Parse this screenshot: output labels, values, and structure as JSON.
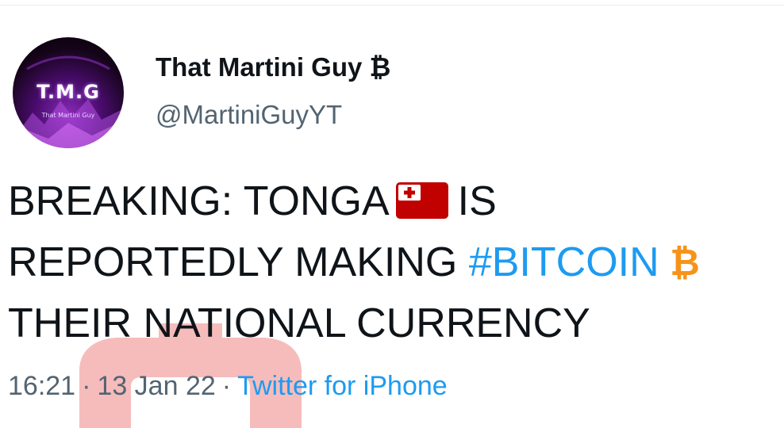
{
  "account": {
    "display_name": "That Martini Guy ₿",
    "handle": "@MartiniGuyYT",
    "avatar_logo_text": "T.M.G",
    "avatar_tagline": "That Martini Guy"
  },
  "tweet": {
    "text_line1": "BREAKING: TONGA",
    "text_line1_after_flag": "IS",
    "text_line2": "REPORTEDLY MAKING",
    "hashtag": "#BITCOIN",
    "text_line3": "THEIR NATIONAL CURRENCY",
    "flag_icon": "tonga-flag-emoji",
    "btc_icon": "bitcoin-emoji"
  },
  "meta": {
    "time": "16:21",
    "separator": "·",
    "date": "13 Jan 22",
    "source": "Twitter for iPhone"
  },
  "colors": {
    "link": "#1d9bf0",
    "text": "#0f1419",
    "secondary": "#536471",
    "flag_red": "#c10000",
    "bitcoin_orange": "#f7931a",
    "watermark": "#f3a5a5"
  }
}
